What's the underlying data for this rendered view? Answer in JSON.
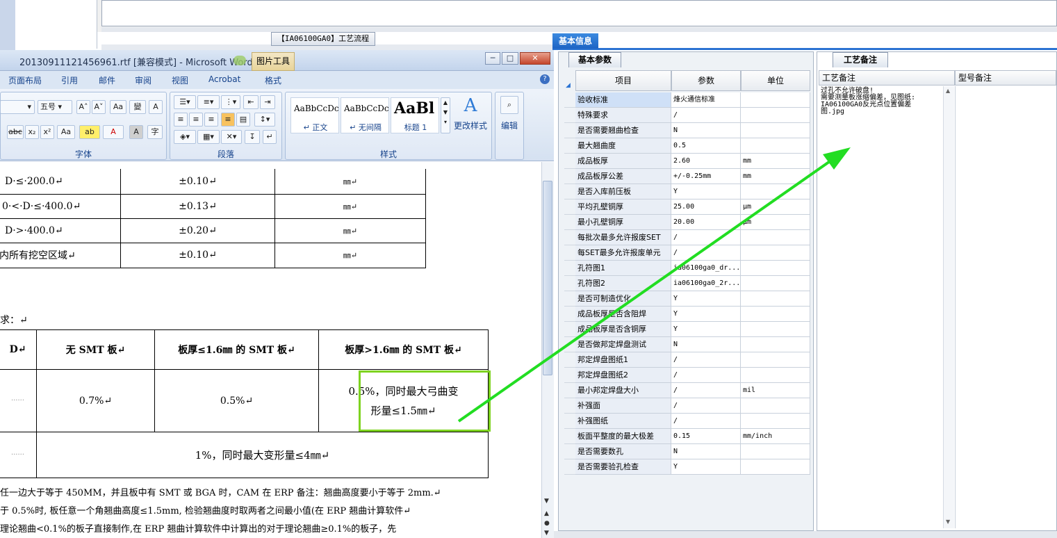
{
  "workflow_tab": "【IA06100GA0】工艺流程",
  "word": {
    "title": "20130911121456961.rtf [兼容模式] - Microsoft Word",
    "context_tab": "图片工具",
    "win_min": "─",
    "win_max": "□",
    "win_close": "✕",
    "tabs": [
      "页面布局",
      "引用",
      "邮件",
      "审阅",
      "视图",
      "Acrobat",
      "格式"
    ],
    "help": "?",
    "font_size": "五号",
    "groups": {
      "font": "字体",
      "paragraph": "段落",
      "styles": "样式",
      "editing": "编辑"
    },
    "styles": [
      {
        "sample": "AaBbCcDc",
        "name": "↵ 正文"
      },
      {
        "sample": "AaBbCcDc",
        "name": "↵ 无间隔"
      },
      {
        "sample": "AaBl",
        "name": "标题 1"
      }
    ],
    "change_styles": "更改样式",
    "font_buttons": [
      "A˄",
      "A˅",
      "Aa",
      "變",
      "A"
    ],
    "font_buttons2": [
      "abc",
      "x₂",
      "x²",
      "Aa",
      "ab",
      "A",
      "A",
      "字"
    ],
    "table1": [
      [
        "D·≤·200.0↵",
        "±0.10↵",
        "㎜↵"
      ],
      [
        "0·<·D·≤·400.0↵",
        "±0.13↵",
        "㎜↵"
      ],
      [
        "D·>·400.0↵",
        "±0.20↵",
        "㎜↵"
      ],
      [
        "内所有挖空区域↵",
        "±0.10↵",
        "㎜↵"
      ]
    ],
    "req_label": "求：↵",
    "table2_header": [
      "D↵",
      "无 SMT 板↵",
      "板厚≤1.6㎜ 的 SMT 板↵",
      "板厚>1.6㎜ 的 SMT 板↵"
    ],
    "table2_row1": [
      "0.7%↵",
      "0.5%↵",
      "0.5%，同时最大弓曲变",
      "形量≤1.5㎜↵"
    ],
    "table2_row2": "1%，同时最大变形量≤4㎜↵",
    "para": [
      "任一边大于等于 450MM，并且板中有 SMT 或 BGA 时，CAM 在 ERP 备注：翘曲高度要小于等于 2mm.↵",
      "于 0.5%时, 板任意一个角翘曲高度≤1.5mm, 检验翘曲度时取两者之间最小值(在 ERP 翘曲计算软件↵",
      "理论翘曲<0.1%的板子直接制作,在 ERP 翘曲计算软件中计算出的对于理论翘曲≥0.1%的板子，先"
    ]
  },
  "right": {
    "basic_tab": "基本信息",
    "param_tab": "基本参数",
    "note_tab": "工艺备注",
    "columns": [
      "项目",
      "参数",
      "单位"
    ],
    "rows": [
      [
        "验收标准",
        "烽火通信标准",
        ""
      ],
      [
        "特殊要求",
        "/",
        ""
      ],
      [
        "是否需要翘曲检查",
        "N",
        ""
      ],
      [
        "最大翘曲度",
        "0.5",
        ""
      ],
      [
        "成品板厚",
        "2.60",
        "mm"
      ],
      [
        "成品板厚公差",
        "+/-0.25mm",
        "mm"
      ],
      [
        "是否入库前压板",
        "Y",
        ""
      ],
      [
        "平均孔壁铜厚",
        "25.00",
        "μm"
      ],
      [
        "最小孔壁铜厚",
        "20.00",
        "μm"
      ],
      [
        "每批次最多允许报废SET",
        "/",
        ""
      ],
      [
        "每SET最多允许报废单元",
        "/",
        ""
      ],
      [
        "孔符图1",
        "ia06100ga0_dr...",
        ""
      ],
      [
        "孔符图2",
        "ia06100ga0_2r...",
        ""
      ],
      [
        "是否可制造优化",
        "Y",
        ""
      ],
      [
        "成品板厚是否含阻焊",
        "Y",
        ""
      ],
      [
        "成品板厚是否含铜厚",
        "Y",
        ""
      ],
      [
        "是否做邦定焊盘测试",
        "N",
        ""
      ],
      [
        "邦定焊盘图纸1",
        "/",
        ""
      ],
      [
        "邦定焊盘图纸2",
        "/",
        ""
      ],
      [
        "最小邦定焊盘大小",
        "/",
        "mil"
      ],
      [
        "补强面",
        "/",
        ""
      ],
      [
        "补强图纸",
        "/",
        ""
      ],
      [
        "板面平整度的最大极差",
        "0.15",
        "mm/inch"
      ],
      [
        "是否需要数孔",
        "N",
        ""
      ],
      [
        "是否需要验孔检查",
        "Y",
        ""
      ]
    ],
    "note_columns": [
      "工艺备注",
      "型号备注"
    ],
    "note_lines": [
      "过孔不允许破盘!",
      "需要测量板涨缩偏差，见图纸:",
      "IA06100GA0反光点位置偏差",
      "图.jpg"
    ]
  },
  "colors": {
    "annotation": "#22dd22",
    "highlight_box": "#7ed320",
    "tab_blue": "#1e64c4"
  }
}
